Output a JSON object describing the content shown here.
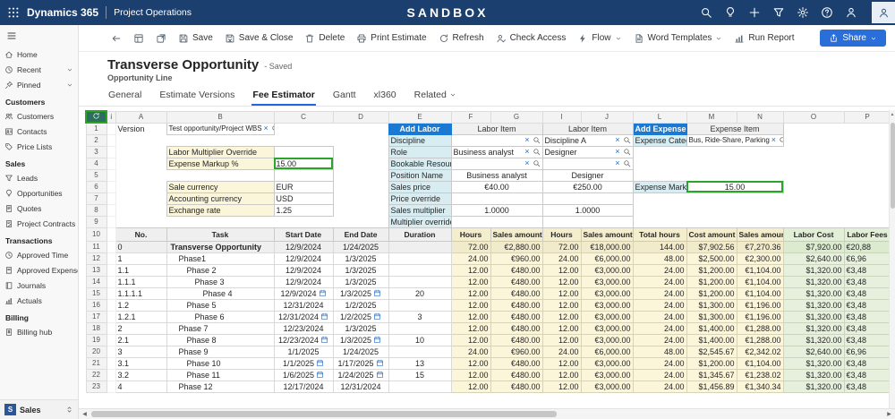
{
  "colors": {
    "topbar_navy": "#1b3f6e",
    "accent_blue": "#1c79d2",
    "share_blue": "#2a6ed9",
    "selection_green": "#2aa52a",
    "yellow_cell": "#fbf5d9",
    "cyan_cell": "#d8edf2",
    "green_cell": "#e7f0dd",
    "tab_underline": "#2266e4"
  },
  "topbar": {
    "app": "Dynamics 365",
    "area": "Project Operations",
    "environment": "SANDBOX",
    "icons": [
      "search",
      "lightbulb",
      "plus",
      "filter",
      "settings",
      "help",
      "person"
    ]
  },
  "sidebar": {
    "sections": [
      {
        "label": "",
        "items": [
          {
            "label": "Home",
            "icon": "home"
          },
          {
            "label": "Recent",
            "icon": "clock",
            "chevron": true
          },
          {
            "label": "Pinned",
            "icon": "pin",
            "chevron": true
          }
        ]
      },
      {
        "label": "Customers",
        "items": [
          {
            "label": "Customers",
            "icon": "people"
          },
          {
            "label": "Contacts",
            "icon": "contact"
          },
          {
            "label": "Price Lists",
            "icon": "tag"
          }
        ]
      },
      {
        "label": "Sales",
        "items": [
          {
            "label": "Leads",
            "icon": "funnel"
          },
          {
            "label": "Opportunities",
            "icon": "lightbulb"
          },
          {
            "label": "Quotes",
            "icon": "quote"
          },
          {
            "label": "Project Contracts",
            "icon": "contract"
          }
        ]
      },
      {
        "label": "Transactions",
        "items": [
          {
            "label": "Approved Time",
            "icon": "clock"
          },
          {
            "label": "Approved Expenses",
            "icon": "receipt"
          },
          {
            "label": "Journals",
            "icon": "book"
          },
          {
            "label": "Actuals",
            "icon": "chart"
          }
        ]
      },
      {
        "label": "Billing",
        "items": [
          {
            "label": "Billing hub",
            "icon": "invoice"
          }
        ]
      }
    ],
    "footer": {
      "initial": "S",
      "label": "Sales"
    }
  },
  "commandbar": {
    "tools": [
      "board",
      "popout"
    ],
    "buttons": [
      {
        "label": "Save",
        "icon": "save"
      },
      {
        "label": "Save & Close",
        "icon": "saveclose"
      },
      {
        "label": "Delete",
        "icon": "trash"
      },
      {
        "label": "Print Estimate",
        "icon": "printer"
      },
      {
        "label": "Refresh",
        "icon": "refresh"
      },
      {
        "label": "Check Access",
        "icon": "checkaccess"
      },
      {
        "label": "Flow",
        "icon": "flow",
        "chevron": true
      },
      {
        "label": "Word Templates",
        "icon": "doc",
        "chevron": true
      },
      {
        "label": "Run Report",
        "icon": "chart"
      }
    ],
    "share": {
      "label": "Share"
    }
  },
  "header": {
    "title": "Transverse Opportunity",
    "status": "- Saved",
    "subtitle": "Opportunity Line",
    "tabs": [
      {
        "label": "General"
      },
      {
        "label": "Estimate Versions"
      },
      {
        "label": "Fee Estimator",
        "active": true
      },
      {
        "label": "Gantt"
      },
      {
        "label": "xl360"
      },
      {
        "label": "Related",
        "chevron": true
      }
    ]
  },
  "grid": {
    "column_letters": [
      "A",
      "B",
      "C",
      "D",
      "E",
      "F",
      "G",
      "I",
      "J",
      "L",
      "M",
      "N",
      "O",
      "P"
    ],
    "info_header": "i",
    "row_numbers": [
      "1",
      "2",
      "3",
      "4",
      "5",
      "6",
      "7",
      "8",
      "9",
      "10",
      "11",
      "12",
      "13",
      "14",
      "15",
      "16",
      "17",
      "18",
      "19",
      "20",
      "21",
      "22",
      "23"
    ],
    "top": {
      "version_label": "Version",
      "version_value": "Test opportunity/Project WBS",
      "labor_multiplier_label": "Labor Multiplier Override",
      "expense_markup_label": "Expense Markup %",
      "expense_markup_value": "15.00",
      "sale_currency_label": "Sale currency",
      "sale_currency_value": "EUR",
      "accounting_currency_label": "Accounting currency",
      "accounting_currency_value": "USD",
      "exchange_rate_label": "Exchange rate",
      "exchange_rate_value": "1.25",
      "add_labor": "Add Labor",
      "add_expense": "Add Expense",
      "labor_item": "Labor Item",
      "expense_item": "Expense Item",
      "discipline_label": "Discipline",
      "role_label": "Role",
      "bookable_resource_label": "Bookable Resource",
      "position_name_label": "Position Name",
      "sales_price_label": "Sales price",
      "price_override_label": "Price override",
      "sales_multiplier_label": "Sales multiplier",
      "multiplier_override_label": "Multiplier override",
      "labor1": {
        "role": "Business analyst",
        "position": "Business analyst",
        "sales_price": "€40.00",
        "sales_multiplier": "1.0000"
      },
      "labor2": {
        "discipline": "Discipline A",
        "role": "Designer",
        "position": "Designer",
        "sales_price": "€250.00",
        "sales_multiplier": "1.0000"
      },
      "expense": {
        "category_label": "Expense Category",
        "category_value": "Bus, Ride-Share, Parking",
        "markup_label": "Expense Markup %",
        "markup_value": "15.00"
      }
    },
    "table": {
      "headers": [
        "No.",
        "Task",
        "Start Date",
        "End Date",
        "Duration",
        "Hours",
        "Sales amount",
        "Hours",
        "Sales amount",
        "Total hours",
        "Cost amount",
        "Sales amount",
        "Labor Cost",
        "Labor Fees"
      ],
      "rows": [
        {
          "no": "0",
          "task": "Transverse Opportunity",
          "indent": 0,
          "sum": true,
          "cal": false,
          "start": "12/9/2024",
          "end": "1/24/2025",
          "dur": "",
          "h1": "72.00",
          "s1": "€2,880.00",
          "h2": "72.00",
          "s2": "€18,000.00",
          "total": "144.00",
          "cost": "$7,902.56",
          "sales": "€7,270.36",
          "labor_cost": "$7,920.00",
          "labor_fees": "€20,88"
        },
        {
          "no": "1",
          "task": "Phase1",
          "indent": 1,
          "cal": false,
          "start": "12/9/2024",
          "end": "1/3/2025",
          "dur": "",
          "h1": "24.00",
          "s1": "€960.00",
          "h2": "24.00",
          "s2": "€6,000.00",
          "total": "48.00",
          "cost": "$2,500.00",
          "sales": "€2,300.00",
          "labor_cost": "$2,640.00",
          "labor_fees": "€6,96"
        },
        {
          "no": "1.1",
          "task": "Phase 2",
          "indent": 2,
          "cal": false,
          "start": "12/9/2024",
          "end": "1/3/2025",
          "dur": "",
          "h1": "12.00",
          "s1": "€480.00",
          "h2": "12.00",
          "s2": "€3,000.00",
          "total": "24.00",
          "cost": "$1,200.00",
          "sales": "€1,104.00",
          "labor_cost": "$1,320.00",
          "labor_fees": "€3,48"
        },
        {
          "no": "1.1.1",
          "task": "Phase 3",
          "indent": 3,
          "cal": false,
          "start": "12/9/2024",
          "end": "1/3/2025",
          "dur": "",
          "h1": "12.00",
          "s1": "€480.00",
          "h2": "12.00",
          "s2": "€3,000.00",
          "total": "24.00",
          "cost": "$1,200.00",
          "sales": "€1,104.00",
          "labor_cost": "$1,320.00",
          "labor_fees": "€3,48"
        },
        {
          "no": "1.1.1.1",
          "task": "Phase 4",
          "indent": 4,
          "cal": true,
          "start": "12/9/2024",
          "end": "1/3/2025",
          "dur": "20",
          "h1": "12.00",
          "s1": "€480.00",
          "h2": "12.00",
          "s2": "€3,000.00",
          "total": "24.00",
          "cost": "$1,200.00",
          "sales": "€1,104.00",
          "labor_cost": "$1,320.00",
          "labor_fees": "€3,48"
        },
        {
          "no": "1.2",
          "task": "Phase 5",
          "indent": 2,
          "cal": false,
          "start": "12/31/2024",
          "end": "1/2/2025",
          "dur": "",
          "h1": "12.00",
          "s1": "€480.00",
          "h2": "12.00",
          "s2": "€3,000.00",
          "total": "24.00",
          "cost": "$1,300.00",
          "sales": "€1,196.00",
          "labor_cost": "$1,320.00",
          "labor_fees": "€3,48"
        },
        {
          "no": "1.2.1",
          "task": "Phase 6",
          "indent": 3,
          "cal": true,
          "start": "12/31/2024",
          "end": "1/2/2025",
          "dur": "3",
          "h1": "12.00",
          "s1": "€480.00",
          "h2": "12.00",
          "s2": "€3,000.00",
          "total": "24.00",
          "cost": "$1,300.00",
          "sales": "€1,196.00",
          "labor_cost": "$1,320.00",
          "labor_fees": "€3,48"
        },
        {
          "no": "2",
          "task": "Phase 7",
          "indent": 1,
          "cal": false,
          "start": "12/23/2024",
          "end": "1/3/2025",
          "dur": "",
          "h1": "12.00",
          "s1": "€480.00",
          "h2": "12.00",
          "s2": "€3,000.00",
          "total": "24.00",
          "cost": "$1,400.00",
          "sales": "€1,288.00",
          "labor_cost": "$1,320.00",
          "labor_fees": "€3,48"
        },
        {
          "no": "2.1",
          "task": "Phase 8",
          "indent": 2,
          "cal": true,
          "start": "12/23/2024",
          "end": "1/3/2025",
          "dur": "10",
          "h1": "12.00",
          "s1": "€480.00",
          "h2": "12.00",
          "s2": "€3,000.00",
          "total": "24.00",
          "cost": "$1,400.00",
          "sales": "€1,288.00",
          "labor_cost": "$1,320.00",
          "labor_fees": "€3,48"
        },
        {
          "no": "3",
          "task": "Phase 9",
          "indent": 1,
          "cal": false,
          "start": "1/1/2025",
          "end": "1/24/2025",
          "dur": "",
          "h1": "24.00",
          "s1": "€960.00",
          "h2": "24.00",
          "s2": "€6,000.00",
          "total": "48.00",
          "cost": "$2,545.67",
          "sales": "€2,342.02",
          "labor_cost": "$2,640.00",
          "labor_fees": "€6,96"
        },
        {
          "no": "3.1",
          "task": "Phase 10",
          "indent": 2,
          "cal": true,
          "start": "1/1/2025",
          "end": "1/17/2025",
          "dur": "13",
          "h1": "12.00",
          "s1": "€480.00",
          "h2": "12.00",
          "s2": "€3,000.00",
          "total": "24.00",
          "cost": "$1,200.00",
          "sales": "€1,104.00",
          "labor_cost": "$1,320.00",
          "labor_fees": "€3,48"
        },
        {
          "no": "3.2",
          "task": "Phase 11",
          "indent": 2,
          "cal": true,
          "start": "1/6/2025",
          "end": "1/24/2025",
          "dur": "15",
          "h1": "12.00",
          "s1": "€480.00",
          "h2": "12.00",
          "s2": "€3,000.00",
          "total": "24.00",
          "cost": "$1,345.67",
          "sales": "€1,238.02",
          "labor_cost": "$1,320.00",
          "labor_fees": "€3,48"
        },
        {
          "no": "4",
          "task": "Phase 12",
          "indent": 1,
          "cal": false,
          "start": "12/17/2024",
          "end": "12/31/2024",
          "dur": "",
          "h1": "12.00",
          "s1": "€480.00",
          "h2": "12.00",
          "s2": "€3,000.00",
          "total": "24.00",
          "cost": "$1,456.89",
          "sales": "€1,340.34",
          "labor_cost": "$1,320.00",
          "labor_fees": "€3,48"
        }
      ]
    }
  }
}
